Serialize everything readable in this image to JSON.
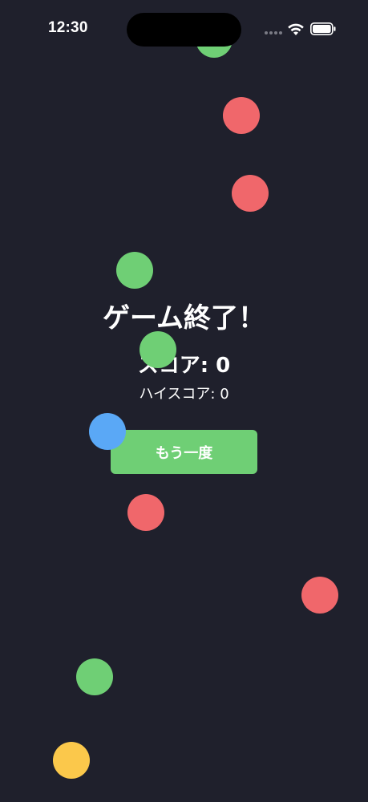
{
  "status_bar": {
    "time": "12:30",
    "icons": [
      "signal-dots-icon",
      "wifi-icon",
      "battery-icon"
    ]
  },
  "game_over": {
    "title": "ゲーム終了！",
    "score_label": "スコア: 0",
    "high_score_label": "ハイスコア: 0",
    "retry_button_label": "もう一度"
  },
  "game_state": {
    "score": 0,
    "high_score": 0
  },
  "colors": {
    "background": "#1f202c",
    "green_ball": "#6fcf75",
    "red_ball": "#f0676b",
    "blue_ball": "#5aa8f6",
    "yellow_ball": "#fbc84b",
    "button": "#6fcf75",
    "text": "#ffffff"
  },
  "balls": [
    {
      "color": "green"
    },
    {
      "color": "red"
    },
    {
      "color": "red"
    },
    {
      "color": "green"
    },
    {
      "color": "green"
    },
    {
      "color": "blue"
    },
    {
      "color": "red"
    },
    {
      "color": "red"
    },
    {
      "color": "green"
    },
    {
      "color": "yellow"
    }
  ]
}
